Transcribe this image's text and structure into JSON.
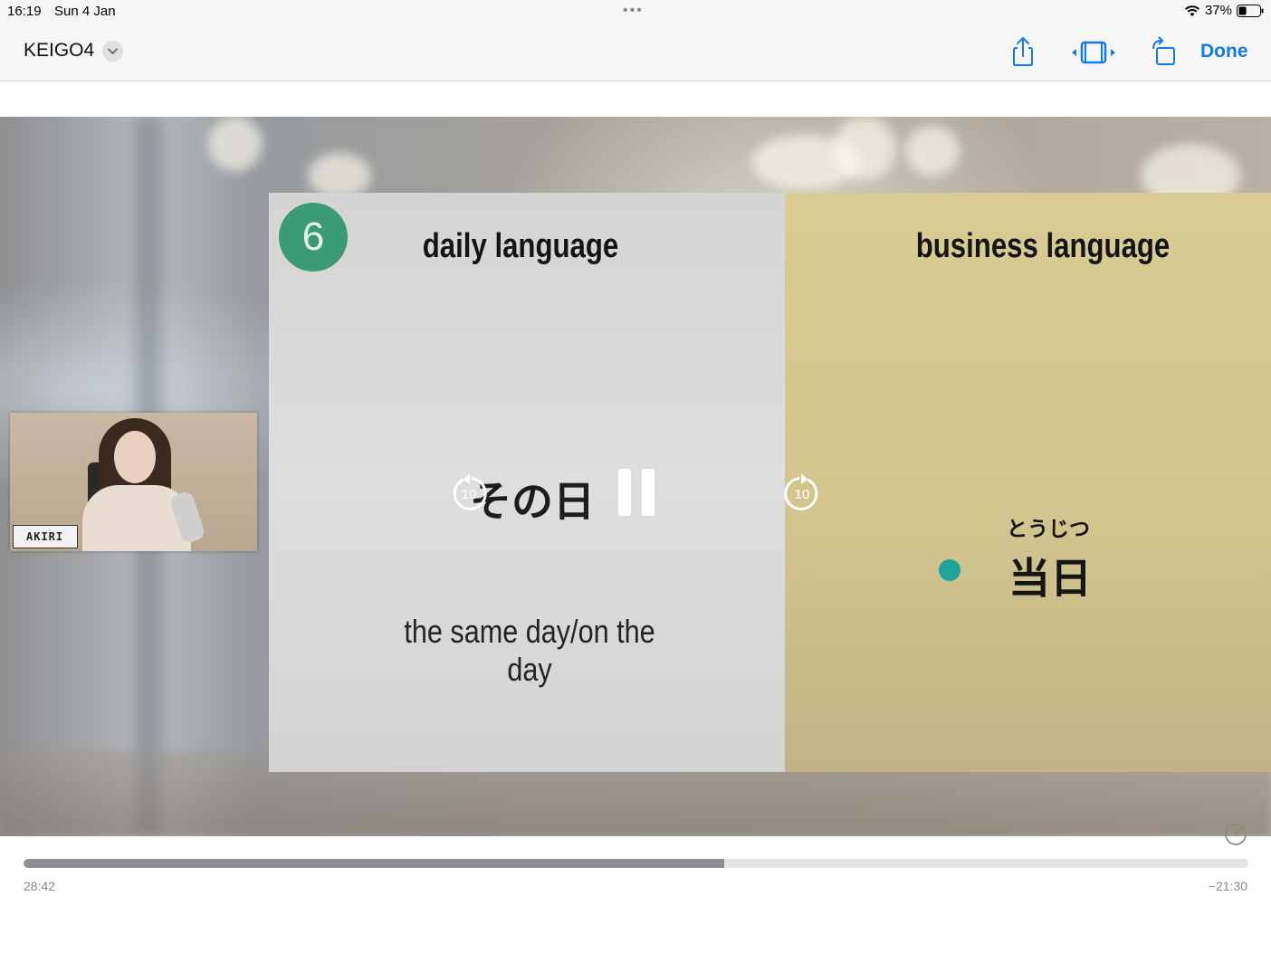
{
  "status_bar": {
    "time": "16:19",
    "date": "Sun 4 Jan",
    "battery": "37%",
    "battery_level": 0.37,
    "icons": [
      "multitask-dots-icon",
      "wifi-icon",
      "battery-icon"
    ]
  },
  "nav": {
    "title": "KEIGO4",
    "done_label": "Done",
    "accent_color": "#1479e6",
    "icons": [
      "chevron-down-icon",
      "share-icon",
      "video-frame-icon",
      "rotate-icon"
    ]
  },
  "slide": {
    "number": "6",
    "daily_heading": "daily language",
    "business_heading": "business language",
    "daily_term": "その日",
    "daily_translation": "the same day/on the day",
    "business_reading": "とうじつ",
    "business_term": "当日",
    "number_color": "#3a9b74",
    "business_bg_color": "#d4c890"
  },
  "webcam": {
    "name_tag": "AKIRI"
  },
  "player": {
    "skip_back_label": "10",
    "skip_forward_label": "10",
    "elapsed": "28:42",
    "remaining": "−21:30",
    "progress": 0.572,
    "icons": [
      "skip-back-10-icon",
      "pause-icon",
      "skip-forward-10-icon",
      "playback-speed-icon"
    ]
  }
}
